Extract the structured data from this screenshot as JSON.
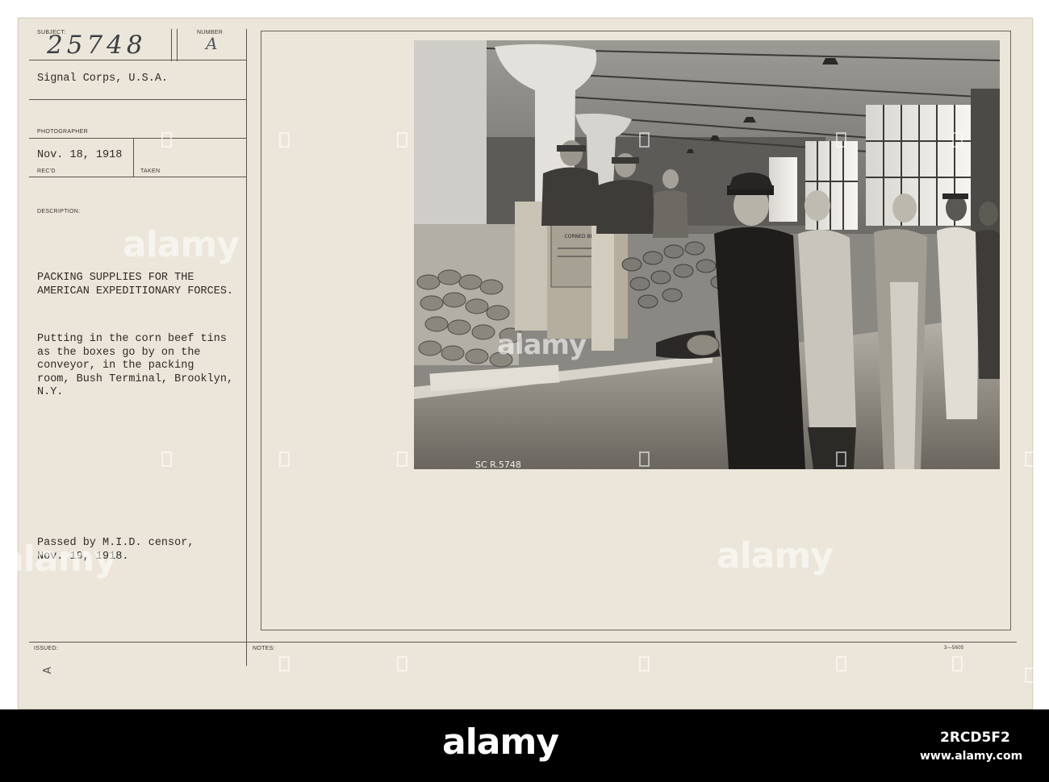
{
  "card": {
    "subject_label": "SUBJECT:",
    "subject_number": "25748",
    "number_label": "NUMBER",
    "number_value": "A",
    "agency": "Signal Corps, U.S.A.",
    "photographer_label": "PHOTOGRAPHER",
    "received_date": "Nov. 18, 1918",
    "recd_label": "REC'D",
    "taken_label": "TAKEN",
    "description_label": "DESCRIPTION:",
    "title_lines": [
      "PACKING SUPPLIES FOR THE",
      "AMERICAN EXPEDITIONARY FORCES."
    ],
    "description_lines": [
      "Putting in the corn beef tins",
      "as the boxes go by on the",
      "conveyor, in the packing",
      "room, Bush Terminal, Brooklyn,",
      "N.Y."
    ],
    "censor_lines": [
      "Passed by M.I.D. censor,",
      "Nov. 19, 1918."
    ],
    "issued_label": "ISSUED:",
    "issued_mark": "A",
    "notes_label": "NOTES:",
    "form_number": "3—5605"
  },
  "photo": {
    "negative_number": "SC R.5748",
    "crate_label": "CORNED BEEF"
  },
  "watermark": {
    "text": "alamy"
  },
  "footer": {
    "logo": "alamy",
    "image_id": "2RCD5F2",
    "site": "www.alamy.com"
  }
}
